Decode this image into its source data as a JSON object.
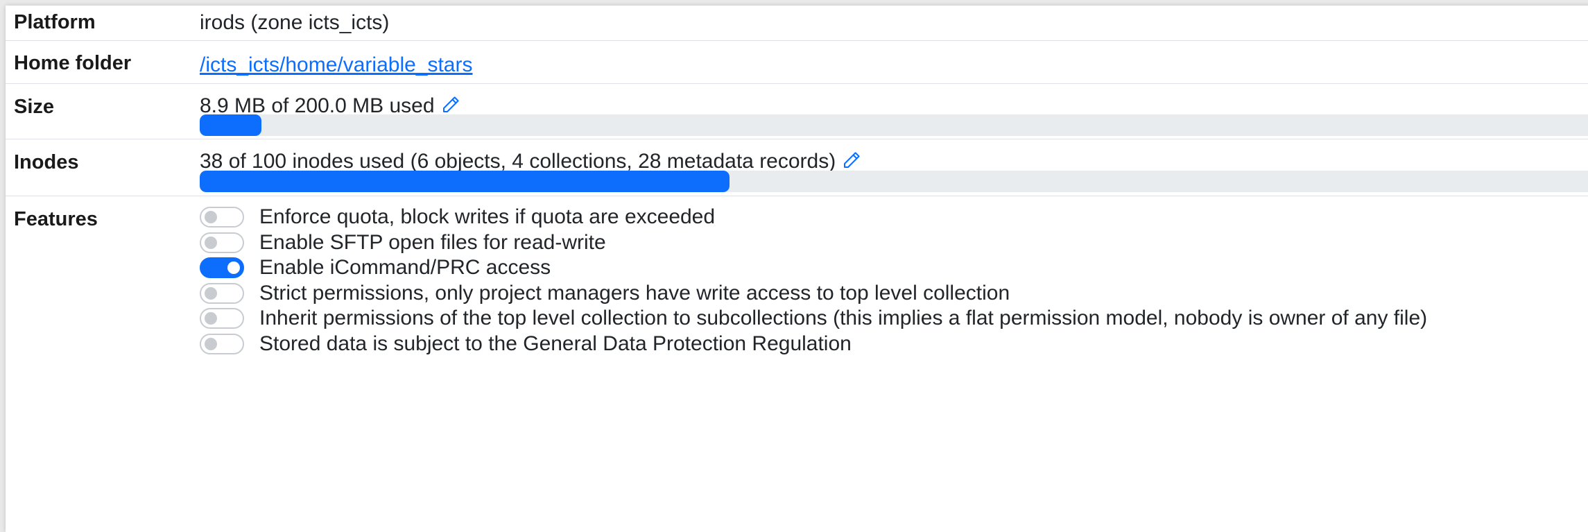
{
  "colors": {
    "accent": "#0d6efd",
    "track": "#e9ecef",
    "toggle_off": "#c8ccd0"
  },
  "platform": {
    "label": "Platform",
    "value": "irods (zone icts_icts)"
  },
  "home_folder": {
    "label": "Home folder",
    "link": "/icts_icts/home/variable_stars"
  },
  "size": {
    "label": "Size",
    "text": "8.9 MB of 200.0 MB used",
    "used_fraction": 0.0445,
    "edit_icon": "pencil-icon"
  },
  "inodes": {
    "label": "Inodes",
    "text": "38 of 100 inodes used (6 objects, 4 collections, 28 metadata records)",
    "used_fraction": 0.38,
    "edit_icon": "pencil-icon"
  },
  "features": {
    "label": "Features",
    "items": [
      {
        "label": "Enforce quota, block writes if quota are exceeded",
        "enabled": false
      },
      {
        "label": "Enable SFTP open files for read-write",
        "enabled": false
      },
      {
        "label": "Enable iCommand/PRC access",
        "enabled": true
      },
      {
        "label": "Strict permissions, only project managers have write access to top level collection",
        "enabled": false
      },
      {
        "label": "Inherit permissions of the top level collection to subcollections (this implies a flat permission model, nobody is owner of any file)",
        "enabled": false
      },
      {
        "label": "Stored data is subject to the General Data Protection Regulation",
        "enabled": false
      }
    ]
  }
}
